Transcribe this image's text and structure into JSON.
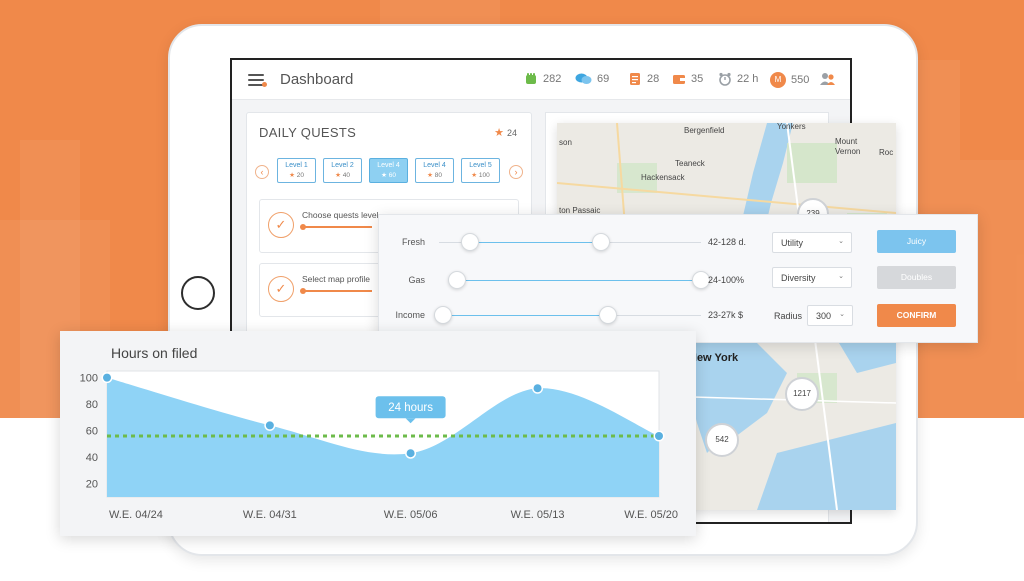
{
  "header": {
    "title": "Dashboard",
    "stats": [
      {
        "icon": "fist-icon",
        "value": "282",
        "color": "#6dbb4a"
      },
      {
        "icon": "chat-bubbles-icon",
        "value": "69",
        "color": "#3ea6e0"
      },
      {
        "icon": "notes-icon",
        "value": "28",
        "color": "#f0894a"
      },
      {
        "icon": "wallet-icon",
        "value": "35",
        "color": "#f0894a"
      },
      {
        "icon": "alarm-clock-icon",
        "value": "22 h",
        "color": "#9aa0a6"
      },
      {
        "icon": "coin-icon",
        "value": "550",
        "color": "#f0894a",
        "coin_letter": "M"
      },
      {
        "icon": "users-icon",
        "value": "",
        "color": "#f0894a"
      }
    ]
  },
  "quests": {
    "title": "DAILY QUESTS",
    "stars": "24",
    "levels": [
      {
        "label": "Level 1",
        "points": "20",
        "active": false
      },
      {
        "label": "Level 2",
        "points": "40",
        "active": false
      },
      {
        "label": "Level 4",
        "points": "60",
        "active": true
      },
      {
        "label": "Level 4",
        "points": "80",
        "active": false
      },
      {
        "label": "Level 5",
        "points": "100",
        "active": false
      }
    ],
    "items": [
      {
        "label": "Choose quests level"
      },
      {
        "label": "Select map profile"
      }
    ]
  },
  "map": {
    "labels": [
      "Bergenfield",
      "Yonkers",
      "son",
      "Mount Vernon",
      "Roc",
      "Teaneck",
      "Hackensack",
      "ton Passaic",
      "New York"
    ],
    "clusters": [
      "239",
      "1217",
      "542"
    ]
  },
  "filters": {
    "rows": [
      {
        "label": "Fresh",
        "range": "42-128 d.",
        "low": 0.12,
        "high": 0.62
      },
      {
        "label": "Gas",
        "range": "24-100%",
        "low": 0.03,
        "high": 1.0
      },
      {
        "label": "Income",
        "range": "23-27k $",
        "low": 0.0,
        "high": 0.64
      }
    ],
    "selects": {
      "utility": "Utility",
      "diversity": "Diversity",
      "radius_label": "Radius",
      "radius_value": "300"
    },
    "buttons": {
      "juicy": "Juicy",
      "doubles": "Doubles",
      "confirm": "CONFIRM"
    },
    "colors": {
      "juicy": "#7cc4ee",
      "doubles": "#d6d8db",
      "confirm": "#f0894a"
    }
  },
  "chart_data": {
    "type": "area",
    "title": "Hours on filed",
    "categories": [
      "W.E. 04/24",
      "W.E. 04/31",
      "W.E. 05/06",
      "W.E. 05/13",
      "W.E. 05/20"
    ],
    "yticks": [
      100,
      80,
      60,
      40,
      20
    ],
    "ylim": [
      10,
      105
    ],
    "points": [
      {
        "x": 0.0,
        "y": 100
      },
      {
        "x": 0.295,
        "y": 64
      },
      {
        "x": 0.55,
        "y": 43
      },
      {
        "x": 0.78,
        "y": 92
      },
      {
        "x": 1.0,
        "y": 56
      }
    ],
    "reference_line": 56,
    "tooltip": "24 hours",
    "colors": {
      "fill": "#8fd3f6",
      "line": "#6dbb4a",
      "point": "#5ab0e0"
    },
    "grid": false
  }
}
